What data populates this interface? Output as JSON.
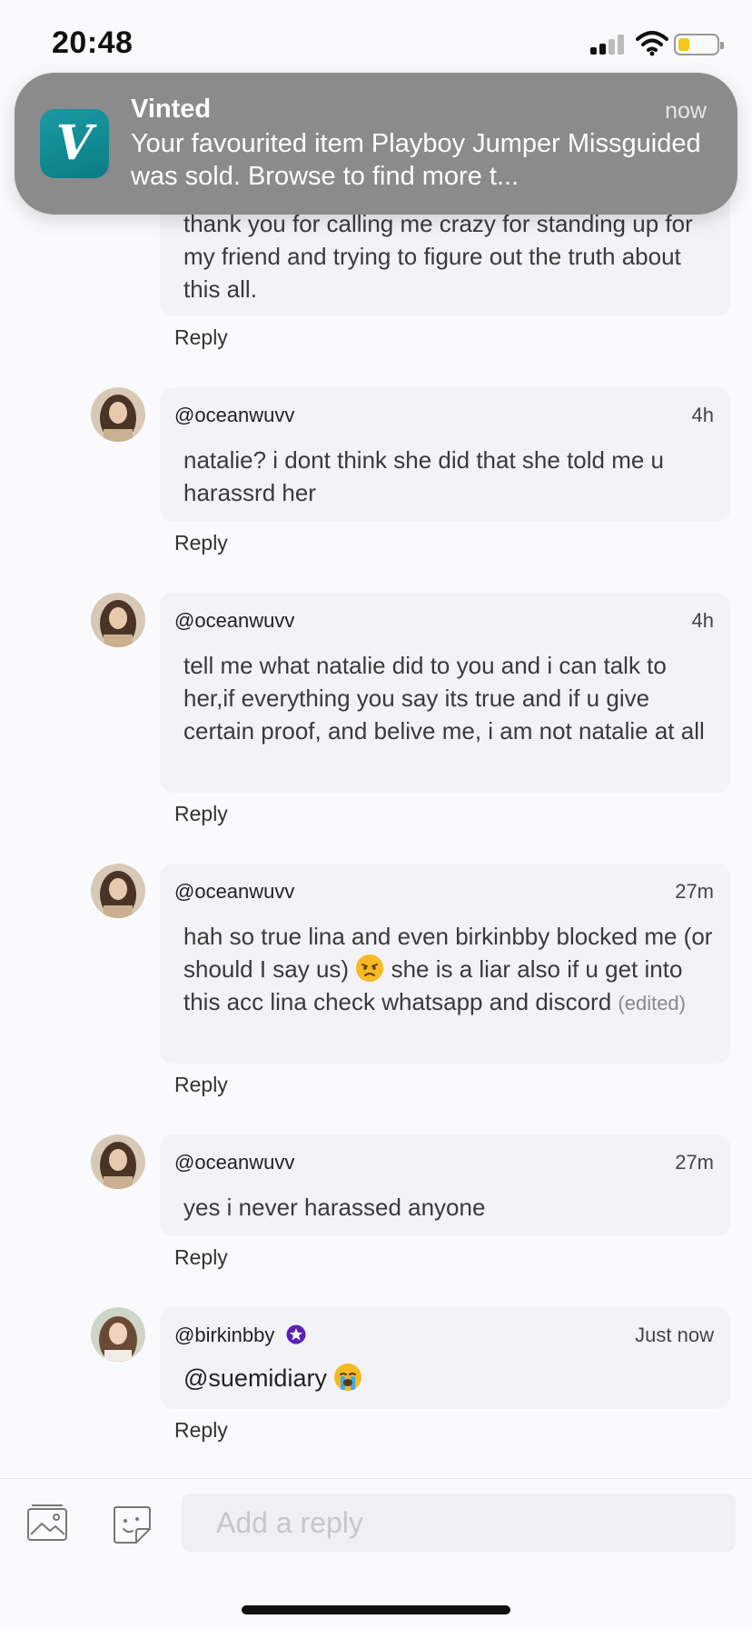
{
  "status_bar": {
    "time": "20:48"
  },
  "notification": {
    "app_name": "Vinted",
    "icon_letter": "V",
    "time": "now",
    "message": "Your favourited item Playboy Jumper Missguided was sold. Browse to find more t..."
  },
  "comments": [
    {
      "username": "",
      "timestamp": "",
      "text": "thank you for calling me crazy for standing up for my friend and trying to figure out the truth about this all.",
      "reply_label": "Reply"
    },
    {
      "username": "@oceanwuvv",
      "timestamp": "4h",
      "text": "natalie? i dont think she did that she told me u harassrd her",
      "reply_label": "Reply"
    },
    {
      "username": "@oceanwuvv",
      "timestamp": "4h",
      "text": "tell me what natalie did to you and i can talk to her,if everything you say its true and if u give certain proof, and belive me, i am not natalie at all",
      "reply_label": "Reply"
    },
    {
      "username": "@oceanwuvv",
      "timestamp": "27m",
      "text_before_emoji": "hah so true lina and even birkinbby blocked me (or should I say us)",
      "emoji": "angry-face",
      "text_after_emoji": "she is a liar also if u get into this acc lina check whatsapp and discord",
      "edited_label": "(edited)",
      "reply_label": "Reply"
    },
    {
      "username": "@oceanwuvv",
      "timestamp": "27m",
      "text": "yes i never harassed anyone",
      "reply_label": "Reply"
    },
    {
      "username": "@birkinbby",
      "verified_badge": "star-badge-icon",
      "timestamp": "Just now",
      "text": "@suemidiary",
      "emoji": "crying-face",
      "reply_label": "Reply"
    }
  ],
  "composer": {
    "placeholder": "Add a reply",
    "image_icon": "image-icon",
    "sticker_icon": "sticker-icon"
  },
  "colors": {
    "accent": "#0b7d86",
    "bubble_bg": "#f3f3f7",
    "badge": "#5b21b6"
  }
}
